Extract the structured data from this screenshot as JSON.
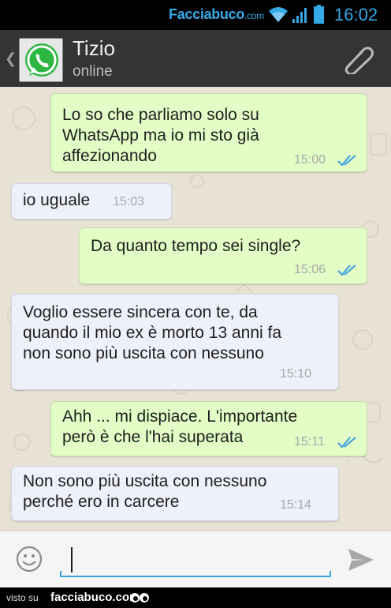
{
  "status_bar": {
    "brand": "Facciabuco",
    "brand_suffix": ".com",
    "time": "16:02",
    "icons": [
      "wifi-icon",
      "signal-icon",
      "battery-icon"
    ],
    "accent_color": "#35a9e6"
  },
  "header": {
    "back_icon": "chevron-left-icon",
    "avatar_icon": "whatsapp-logo",
    "contact_name": "Tizio",
    "contact_status": "online",
    "attach_icon": "paperclip-icon"
  },
  "messages": [
    {
      "direction": "outgoing",
      "text": "Lo so che parliamo solo su\nWhatsApp ma io mi sto già\naffezionando",
      "time": "15:00",
      "read": true
    },
    {
      "direction": "incoming",
      "text": "io uguale",
      "time": "15:03"
    },
    {
      "direction": "outgoing",
      "text": "Da quanto tempo sei single?",
      "time": "15:06",
      "read": true
    },
    {
      "direction": "incoming",
      "text": "Voglio essere sincera con te, da\nquando il mio ex è morto 13 anni fa\nnon sono più uscita con nessuno",
      "time": "15:10"
    },
    {
      "direction": "outgoing",
      "text": "Ahh ... mi dispiace. L'importante\nperò è che l'hai superata",
      "time": "15:11",
      "read": true
    },
    {
      "direction": "incoming",
      "text": "Non sono più uscita con nessuno\nperché ero in carcere",
      "time": "15:14"
    }
  ],
  "colors": {
    "outgoing_bubble": "#e2fdc6",
    "incoming_bubble": "#eef0fa",
    "read_ticks": "#3a9de0",
    "header_bg": "#343434"
  },
  "composer": {
    "input_value": "",
    "emoji_icon": "smiley-icon",
    "send_icon": "send-icon"
  },
  "footer": {
    "visto_su": "visto su",
    "site": "facciabuco.com",
    "logo_icon": "eyes-icon"
  }
}
